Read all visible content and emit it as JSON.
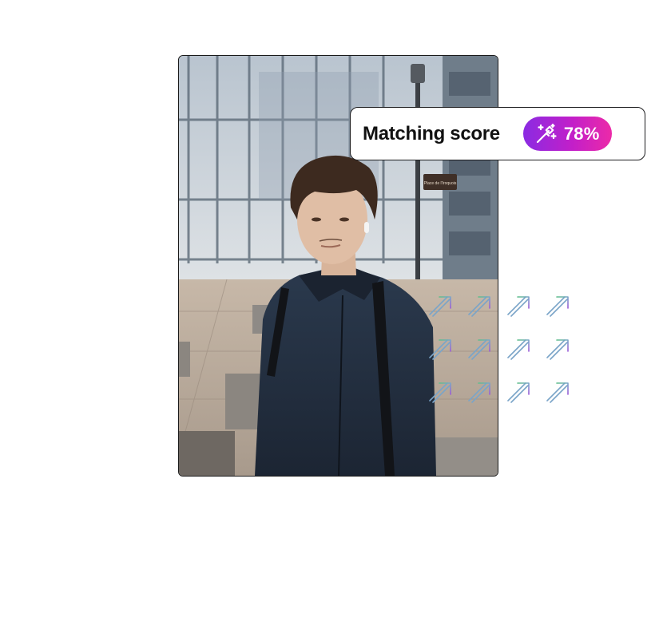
{
  "score_card": {
    "label": "Matching score",
    "icon": "magic-wand-icon",
    "value": "78%"
  },
  "photo": {
    "subject": "portrait-photo",
    "sign_text": "Place de l'Iroquois"
  },
  "colors": {
    "pill_start": "#8a2be2",
    "pill_mid": "#c21fc9",
    "pill_end": "#ec2aa8",
    "border": "#1d1d1f"
  },
  "decor": {
    "icon": "trend-up-arrow-icon",
    "rows": 3,
    "cols": 4
  }
}
